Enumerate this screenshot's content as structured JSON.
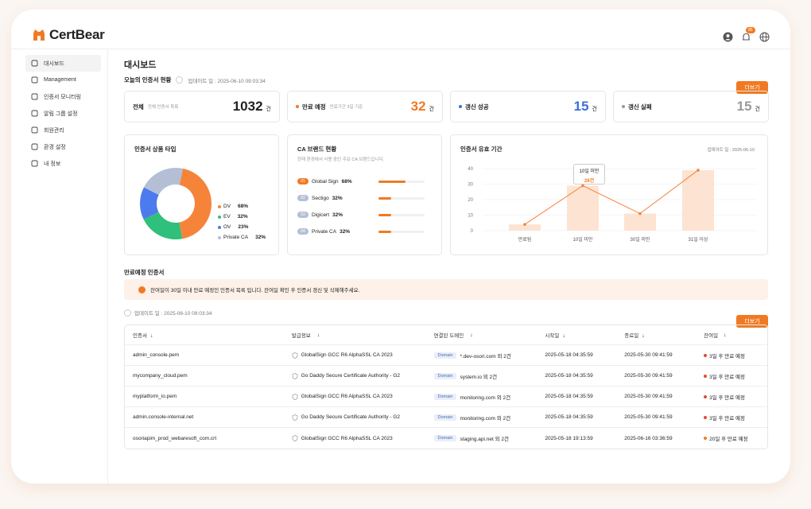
{
  "app": {
    "name": "CertBear",
    "notification_count": "85"
  },
  "sidebar": {
    "items": [
      {
        "label": "대시보드",
        "icon": "grid-icon"
      },
      {
        "label": "Management",
        "icon": "users-icon"
      },
      {
        "label": "인증서 모니터링",
        "icon": "monitor-icon"
      },
      {
        "label": "알림 그룹 설정",
        "icon": "bell-icon"
      },
      {
        "label": "회원관리",
        "icon": "chat-icon"
      },
      {
        "label": "환경 설정",
        "icon": "gear-icon"
      },
      {
        "label": "내 정보",
        "icon": "user-icon"
      }
    ]
  },
  "page": {
    "title": "대시보드",
    "today_title": "오늘의 인증서 현황",
    "updated": "업데이트 일 : 2025-06-10 09:03:34",
    "more_label": "더보기"
  },
  "stats": [
    {
      "label": "전체",
      "sub": "전체 인증서 목록",
      "value": "1032",
      "unit": "건",
      "color": "#222222"
    },
    {
      "label": "만료 예정",
      "sub": "만료기간 3일 기준",
      "value": "32",
      "unit": "건",
      "color": "#f07a24"
    },
    {
      "label": "갱신 성공",
      "sub": "",
      "value": "15",
      "unit": "건",
      "color": "#3b6fd8"
    },
    {
      "label": "갱신 실패",
      "sub": "",
      "value": "15",
      "unit": "건",
      "color": "#9a9a9a"
    }
  ],
  "product_card": {
    "title": "인증서 상품 타입",
    "legend": [
      {
        "label": "DV",
        "value": "68%",
        "color": "#f5843a"
      },
      {
        "label": "EV",
        "value": "32%",
        "color": "#2fc07b"
      },
      {
        "label": "OV",
        "value": "23%",
        "color": "#4b7bec"
      },
      {
        "label": "Private CA",
        "value": "32%",
        "color": "#b4bfd6"
      }
    ],
    "chart_data": {
      "type": "pie",
      "categories": [
        "DV",
        "EV",
        "OV",
        "Private CA"
      ],
      "values": [
        68,
        32,
        23,
        32
      ]
    }
  },
  "brand_card": {
    "title": "CA 브랜드 현황",
    "sub": "현재 환경에서 사용 중인 주요 CA 브랜드입니다.",
    "rows": [
      {
        "num": "01",
        "name": "Global Sign",
        "pct": "68%",
        "fill": 0.58,
        "numColor": "#f07a24"
      },
      {
        "num": "02",
        "name": "Sectigo",
        "pct": "32%",
        "fill": 0.28,
        "numColor": "#b4bfd6"
      },
      {
        "num": "03",
        "name": "Digicert",
        "pct": "32%",
        "fill": 0.28,
        "numColor": "#b4bfd6"
      },
      {
        "num": "04",
        "name": "Private CA",
        "pct": "32%",
        "fill": 0.28,
        "numColor": "#b4bfd6"
      }
    ]
  },
  "validity_card": {
    "title": "인증서 유효 기간",
    "updated": "업데이트 일 : 2025-06-10",
    "tooltip_label": "10일 미만",
    "tooltip_value": "28건",
    "chart_data": {
      "type": "bar",
      "categories": [
        "만료됨",
        "10일 미만",
        "30일 미만",
        "31일 이상"
      ],
      "values": [
        4,
        29,
        11,
        39
      ],
      "line_values": [
        4,
        29,
        11,
        39
      ],
      "yticks": [
        0,
        10,
        20,
        30,
        40
      ],
      "ylim": [
        0,
        40
      ]
    }
  },
  "expiring": {
    "title": "만료예정 인증서",
    "notice": "잔여일이 30일 이내 만료 예정인 인증서 목록 입니다. 잔여일 확인 후 인증서 갱신 및 삭제해주세요.",
    "updated": "업데이트 일 : 2025-06-10 09:03:34",
    "more_label": "더보기",
    "columns": [
      "인증서",
      "발급정보",
      "연결된 도메인",
      "시작일",
      "종료일",
      "잔여일"
    ],
    "domain_tag": "Domain",
    "rows": [
      {
        "cert": "admin_console.pem",
        "issuer": "GlobalSign GCC R6 AlphaSSL CA 2023",
        "domain": "*.dev-osori.com 외 2건",
        "start": "2025-05-18 04:35:59",
        "end": "2025-05-30 09:41:59",
        "remain": "3일 후 만료 예정",
        "color": "#e8492c"
      },
      {
        "cert": "mycompany_cloud.pem",
        "issuer": "Go Daddy Secure Certificate Authority - G2",
        "domain": "system.io 외 2건",
        "start": "2025-05-18 04:35:59",
        "end": "2025-05-30 09:41:59",
        "remain": "3일 후 만료 예정",
        "color": "#e8492c"
      },
      {
        "cert": "myplatform_io.pem",
        "issuer": "GlobalSign GCC R6 AlphaSSL CA 2023",
        "domain": "monitoring.com 외 2건",
        "start": "2025-05-18 04:35:59",
        "end": "2025-05-30 09:41:59",
        "remain": "3일 후 만료 예정",
        "color": "#e8492c"
      },
      {
        "cert": "admin.console-internal.net",
        "issuer": "Go Daddy Secure Certificate Authority - G2",
        "domain": "monitoring.com 외 2건",
        "start": "2025-05-18 04:35:59",
        "end": "2025-05-30 09:41:59",
        "remain": "3일 후 만료 예정",
        "color": "#e8492c"
      },
      {
        "cert": "osoriapim_prod_webaresoft_com.crt",
        "issuer": "GlobalSign GCC R6 AlphaSSL CA 2023",
        "domain": "staging.api.net 외 2건",
        "start": "2025-05-18 19:13:59",
        "end": "2025-06-16 03:36:59",
        "remain": "20일 후 만료 예정",
        "color": "#f07a24"
      }
    ]
  }
}
